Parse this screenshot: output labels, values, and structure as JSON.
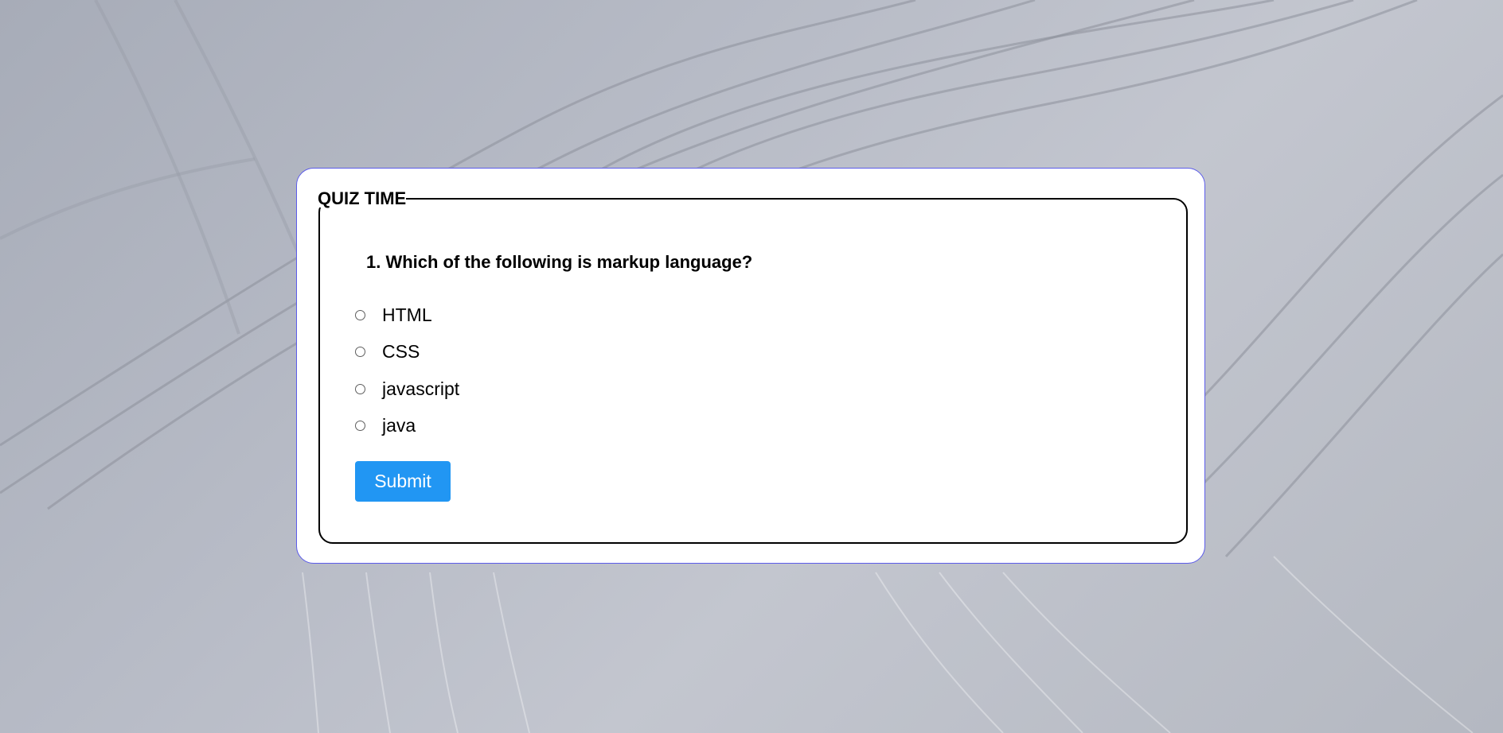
{
  "quiz": {
    "legend": "QUIZ TIME",
    "question": "1. Which of the following is markup language?",
    "options": [
      {
        "label": "HTML"
      },
      {
        "label": "CSS"
      },
      {
        "label": "javascript"
      },
      {
        "label": "java"
      }
    ],
    "submit_label": "Submit"
  },
  "colors": {
    "card_border": "#5b5bea",
    "submit_background": "#2196f3",
    "submit_text": "#ffffff"
  },
  "icons": {
    "option_marker": "radio-button-icon"
  }
}
